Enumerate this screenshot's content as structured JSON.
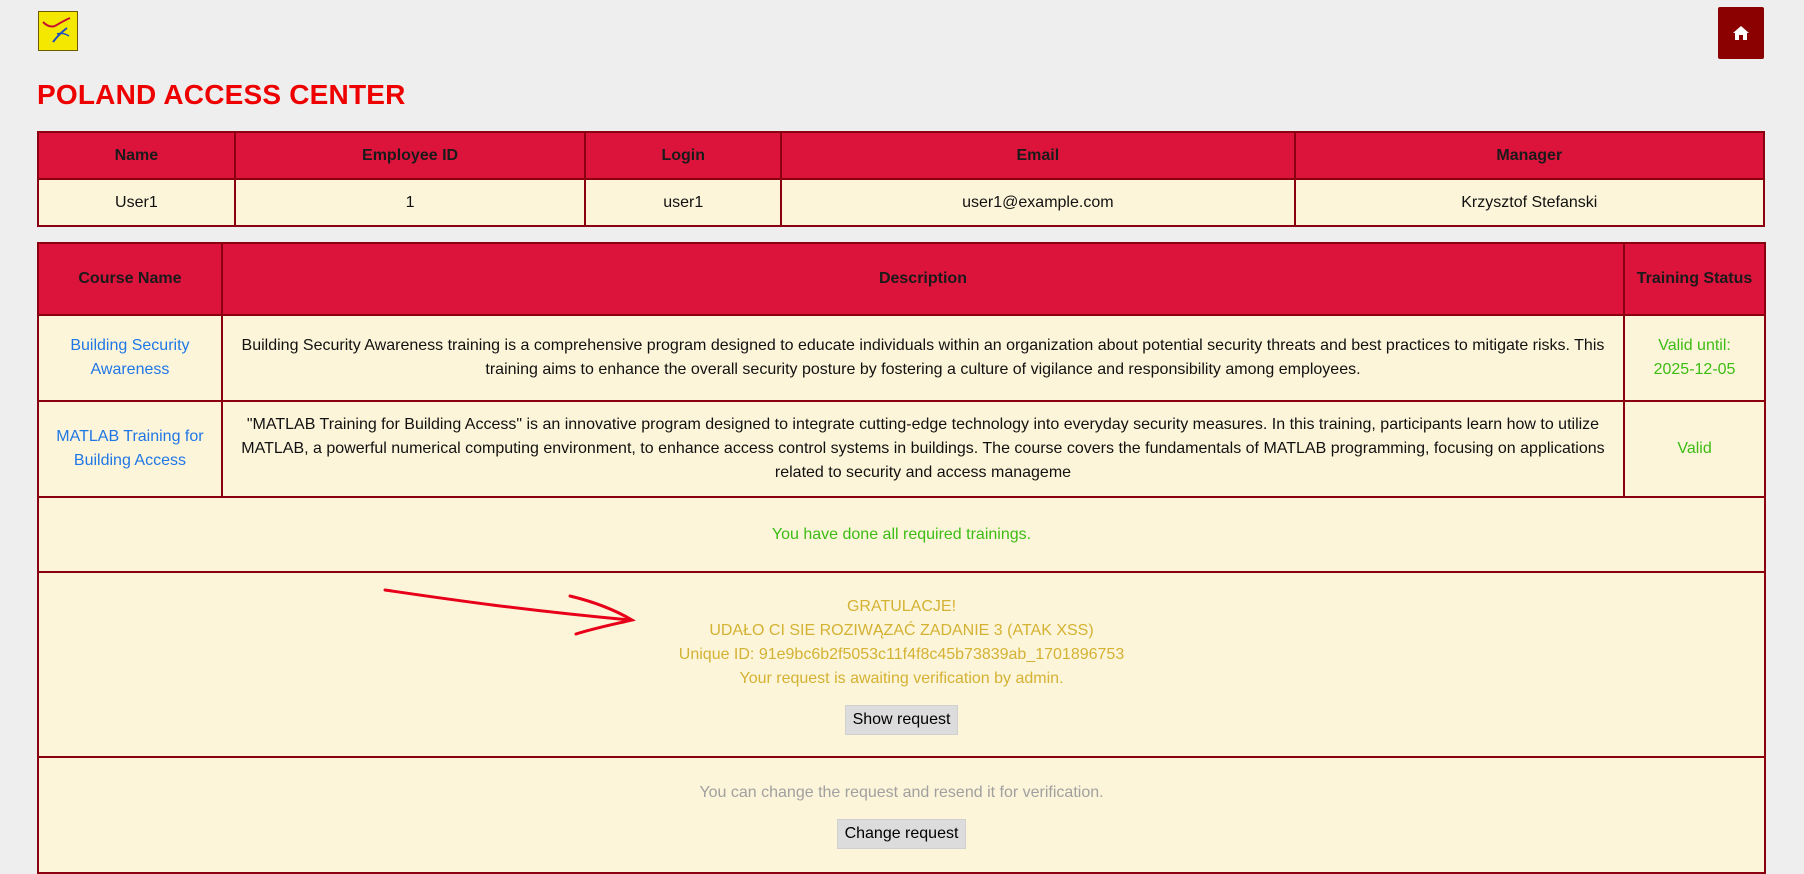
{
  "header": {
    "title": "POLAND ACCESS CENTER",
    "logo_icon": "bird-logo-icon",
    "home_icon": "home-icon",
    "accent": "#8b0000"
  },
  "user_table": {
    "headers": [
      "Name",
      "Employee ID",
      "Login",
      "Email",
      "Manager"
    ],
    "row": [
      "User1",
      "1",
      "user1",
      "user1@example.com",
      "Krzysztof Stefanski"
    ]
  },
  "course_table": {
    "headers": [
      "Course Name",
      "Description",
      "Training Status"
    ],
    "rows": [
      {
        "name": "Building Security Awareness",
        "description": "Building Security Awareness training is a comprehensive program designed to educate individuals within an organization about potential security threats and best practices to mitigate risks. This training aims to enhance the overall security posture by fostering a culture of vigilance and responsibility among employees.",
        "status_line1": "Valid until:",
        "status_line2": "2025-12-05"
      },
      {
        "name": "MATLAB Training for Building Access",
        "description": "\"MATLAB Training for Building Access\" is an innovative program designed to integrate cutting-edge technology into everyday security measures. In this training, participants learn how to utilize MATLAB, a powerful numerical computing environment, to enhance access control systems in buildings. The course covers the fundamentals of MATLAB programming, focusing on applications related to security and access manageme",
        "status": "Valid"
      }
    ]
  },
  "done_message": "You have done all required trainings.",
  "congrats": {
    "line1": "GRATULACJE!",
    "line2": "UDAŁO CI SIE ROZIWĄZAĆ ZADANIE 3 (ATAK XSS)",
    "line3": "Unique ID: 91e9bc6b2f5053c11f4f8c45b73839ab_1701896753",
    "line4": "Your request is awaiting verification by admin.",
    "button": "Show request"
  },
  "resend": {
    "message": "You can change the request and resend it for verification.",
    "button": "Change request"
  },
  "colors": {
    "header_red": "#dc143c",
    "title_red": "#ee0000",
    "valid_green": "#3cbc14",
    "congrats_gold": "#d4b233",
    "link_blue": "#1f77e6"
  }
}
